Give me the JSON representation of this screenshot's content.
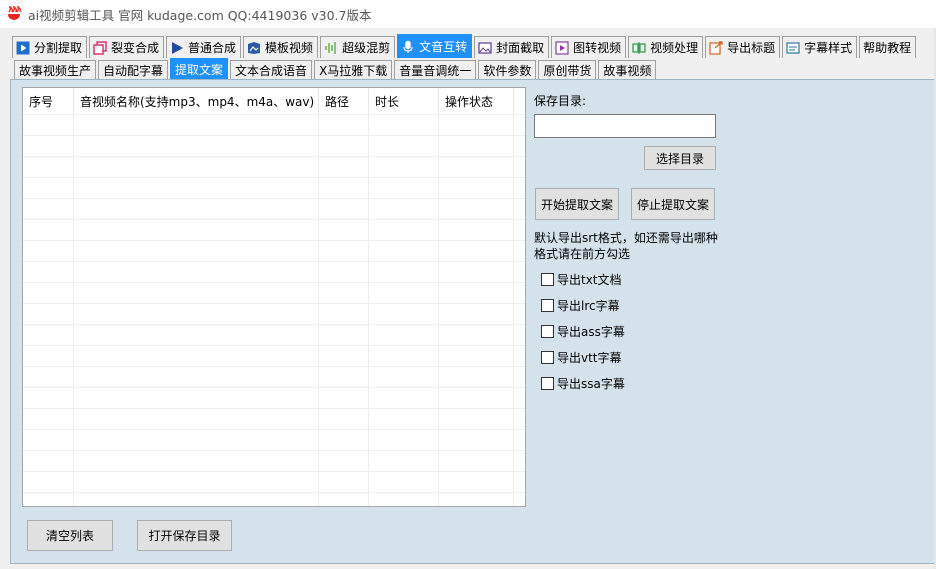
{
  "window": {
    "title": "ai视频剪辑工具 官网 kudage.com QQ:4419036    v30.7版本"
  },
  "main_tabs": [
    {
      "label": "分割提取",
      "icon": "play-icon"
    },
    {
      "label": "裂变合成",
      "icon": "copy-icon"
    },
    {
      "label": "普通合成",
      "icon": "play-arrow-icon"
    },
    {
      "label": "模板视频",
      "icon": "template-icon"
    },
    {
      "label": "超级混剪",
      "icon": "waveform-icon"
    },
    {
      "label": "文音互转",
      "icon": "microphone-icon"
    },
    {
      "label": "封面截取",
      "icon": "image-icon"
    },
    {
      "label": "图转视频",
      "icon": "photo-video-icon"
    },
    {
      "label": "视频处理",
      "icon": "process-icon"
    },
    {
      "label": "导出标题",
      "icon": "export-icon"
    },
    {
      "label": "字幕样式",
      "icon": "subtitle-icon"
    },
    {
      "label": "帮助教程",
      "icon": ""
    }
  ],
  "sub_tabs": [
    {
      "label": "故事视频生产"
    },
    {
      "label": "自动配字幕"
    },
    {
      "label": "提取文案"
    },
    {
      "label": "文本合成语音"
    },
    {
      "label": "X马拉雅下载"
    },
    {
      "label": "音量音调统一"
    },
    {
      "label": "软件参数"
    },
    {
      "label": "原创带货"
    },
    {
      "label": "故事视频"
    }
  ],
  "table": {
    "columns": [
      "序号",
      "音视频名称(支持mp3、mp4、m4a、wav)",
      "路径",
      "时长",
      "操作状态"
    ],
    "rows": []
  },
  "right_panel": {
    "save_dir_label": "保存目录:",
    "save_dir_value": "",
    "choose_dir_button": "选择目录",
    "start_button": "开始提取文案",
    "stop_button": "停止提取文案",
    "hint_line1": "默认导出srt格式，如还需导出哪种",
    "hint_line2": "格式请在前方勾选",
    "export_options": [
      {
        "label": "导出txt文档",
        "checked": false
      },
      {
        "label": "导出lrc字幕",
        "checked": false
      },
      {
        "label": "导出ass字幕",
        "checked": false
      },
      {
        "label": "导出vtt字幕",
        "checked": false
      },
      {
        "label": "导出ssa字幕",
        "checked": false
      }
    ]
  },
  "bottom_buttons": {
    "clear_list": "清空列表",
    "open_save_dir": "打开保存目录"
  },
  "colors": {
    "active_tab": "#1e90ff",
    "panel_bg": "#d4e2ec",
    "app_icon": "#e8251e"
  }
}
